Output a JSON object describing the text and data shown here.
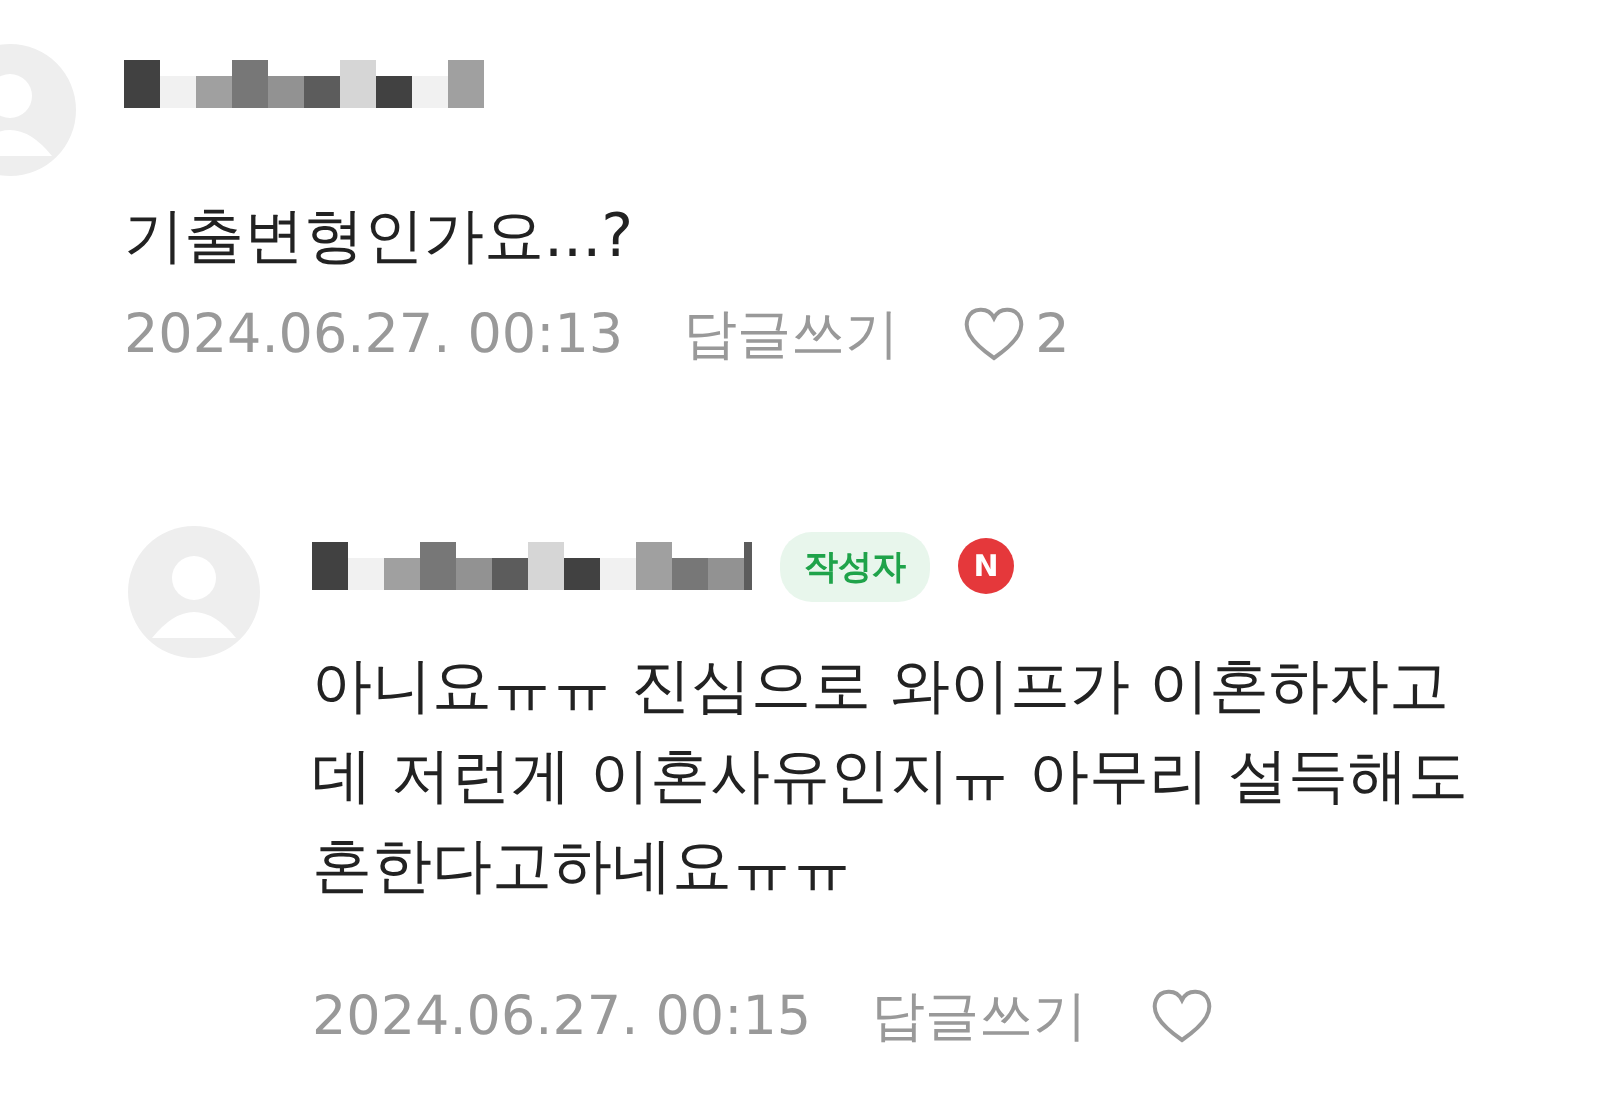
{
  "comments": [
    {
      "text_lines": [
        "기출변형인가요...?"
      ],
      "date": "2024.06.27. 00:13",
      "reply_label": "답글쓰기",
      "likes": "2",
      "is_reply": false
    },
    {
      "author_badge": "작성자",
      "new_mark": "N",
      "text_lines": [
        "아니요ㅠㅠ 진심으로 와이프가 이혼하자고",
        "데 저런게 이혼사유인지ㅠ 아무리 설득해도",
        "혼한다고하네요ㅠㅠ"
      ],
      "date": "2024.06.27. 00:15",
      "reply_label": "답글쓰기",
      "is_reply": true
    }
  ]
}
